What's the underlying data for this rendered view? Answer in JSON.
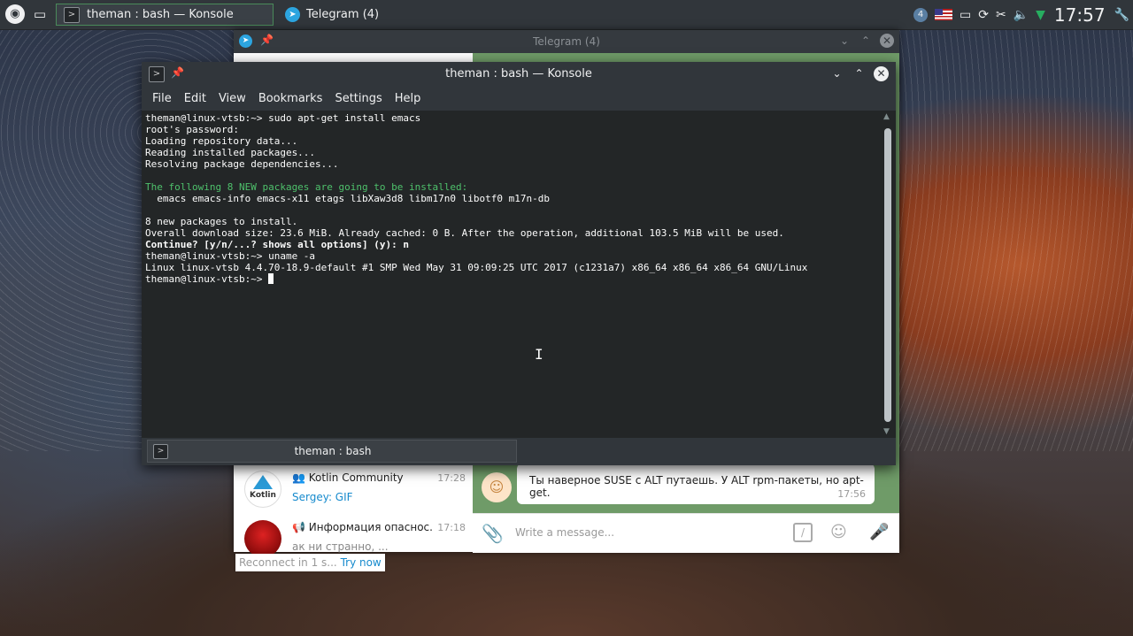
{
  "panel": {
    "active_task": "theman : bash — Konsole",
    "telegram_task": "Telegram (4)",
    "tray_badge": "4",
    "clock": "17:57"
  },
  "telegram": {
    "title": "Telegram (4)",
    "chats": [
      {
        "name": "Kotlin Community",
        "time": "17:28",
        "last": "Sergey: GIF",
        "avatar_text": "Kotlin"
      },
      {
        "name": "Информация опаснос...",
        "time": "17:18",
        "last": "ак ни странно, ..."
      }
    ],
    "reconnect_text": "Reconnect in 1 s...",
    "reconnect_link": "Try now",
    "message": {
      "text": "Ты наверное SUSE с ALT путаешь. У ALT rpm-пакеты, но apt-get.",
      "time": "17:56"
    },
    "composer_placeholder": "Write a message..."
  },
  "konsole": {
    "title": "theman : bash — Konsole",
    "menu": [
      "File",
      "Edit",
      "View",
      "Bookmarks",
      "Settings",
      "Help"
    ],
    "lines": [
      "theman@linux-vtsb:~> sudo apt-get install emacs",
      "root's password:",
      "Loading repository data...",
      "Reading installed packages...",
      "Resolving package dependencies...",
      "",
      "The following 8 NEW packages are going to be installed:",
      "  emacs emacs-info emacs-x11 etags libXaw3d8 libm17n0 libotf0 m17n-db",
      "",
      "8 new packages to install.",
      "Overall download size: 23.6 MiB. Already cached: 0 B. After the operation, additional 103.5 MiB will be used.",
      "Continue? [y/n/...? shows all options] (y): n",
      "theman@linux-vtsb:~> uname -a",
      "Linux linux-vtsb 4.4.70-18.9-default #1 SMP Wed May 31 09:09:25 UTC 2017 (c1231a7) x86_64 x86_64 x86_64 GNU/Linux",
      "theman@linux-vtsb:~> "
    ],
    "tab_label": "theman : bash"
  }
}
